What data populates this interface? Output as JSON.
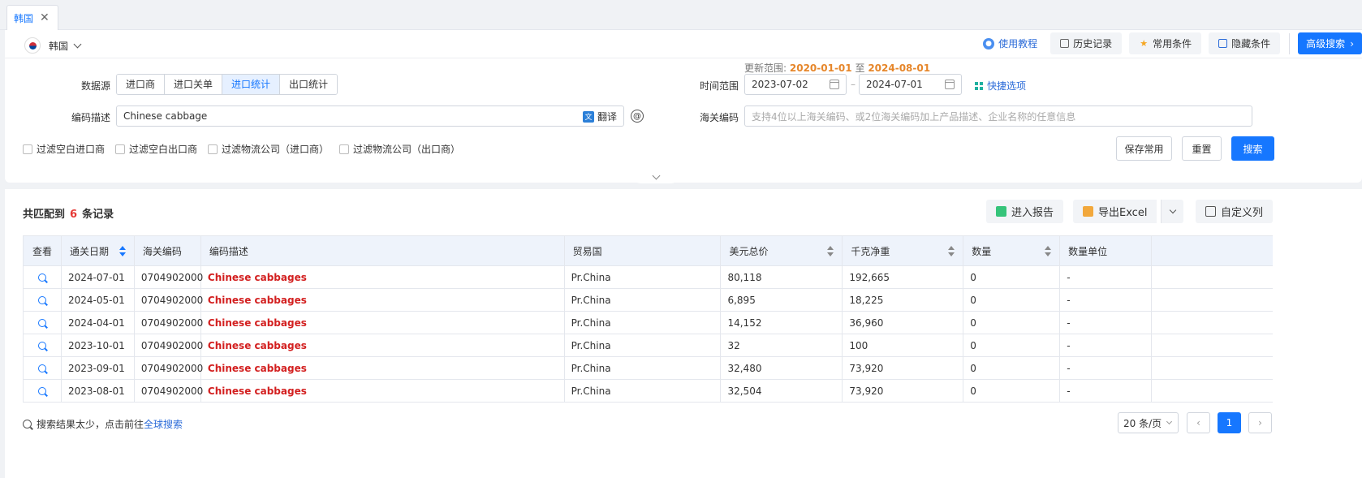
{
  "tab": {
    "label": "韩国",
    "close": "✕"
  },
  "country": {
    "name": "韩国"
  },
  "top_actions": {
    "help": "使用教程",
    "history": "历史记录",
    "common": "常用条件",
    "hide": "隐藏条件",
    "advanced": "高级搜索",
    "advanced_arrow": "›"
  },
  "form": {
    "datasource_label": "数据源",
    "datasource_options": [
      "进口商",
      "进口关单",
      "进口统计",
      "出口统计"
    ],
    "datasource_selected": "进口统计",
    "update_range_prefix": "更新范围:",
    "update_start": "2020-01-01",
    "update_to": "至",
    "update_end": "2024-08-01",
    "time_label": "时间范围",
    "date_from": "2023-07-02",
    "date_to": "2024-07-01",
    "date_sep": "–",
    "quick_options": "快捷选项",
    "desc_label": "编码描述",
    "desc_value": "Chinese cabbage",
    "translate": "翻译",
    "at_symbol": "@",
    "hs_label": "海关编码",
    "hs_placeholder": "支持4位以上海关编码、或2位海关编码加上产品描述、企业名称的任意信息",
    "filters": [
      "过滤空白进口商",
      "过滤空白出口商",
      "过滤物流公司（进口商）",
      "过滤物流公司（出口商）"
    ],
    "save_common": "保存常用",
    "reset": "重置",
    "search": "搜索"
  },
  "results": {
    "prefix": "共匹配到",
    "count": "6",
    "suffix": "条记录",
    "enter_report": "进入报告",
    "export_excel": "导出Excel",
    "custom_columns": "自定义列"
  },
  "table": {
    "headers": [
      "查看",
      "通关日期",
      "海关编码",
      "编码描述",
      "贸易国",
      "美元总价",
      "千克净重",
      "数量",
      "数量单位"
    ],
    "rows": [
      [
        "2024-07-01",
        "0704902000",
        "Chinese cabbages",
        "Pr.China",
        "80,118",
        "192,665",
        "0",
        "-"
      ],
      [
        "2024-05-01",
        "0704902000",
        "Chinese cabbages",
        "Pr.China",
        "6,895",
        "18,225",
        "0",
        "-"
      ],
      [
        "2024-04-01",
        "0704902000",
        "Chinese cabbages",
        "Pr.China",
        "14,152",
        "36,960",
        "0",
        "-"
      ],
      [
        "2023-10-01",
        "0704902000",
        "Chinese cabbages",
        "Pr.China",
        "32",
        "100",
        "0",
        "-"
      ],
      [
        "2023-09-01",
        "0704902000",
        "Chinese cabbages",
        "Pr.China",
        "32,480",
        "73,920",
        "0",
        "-"
      ],
      [
        "2023-08-01",
        "0704902000",
        "Chinese cabbages",
        "Pr.China",
        "32,504",
        "73,920",
        "0",
        "-"
      ]
    ]
  },
  "footer": {
    "hint": "搜索结果太少，点击前往",
    "global_search": "全球搜索",
    "page_size": "20 条/页",
    "prev": "‹",
    "current_page": "1",
    "next": "›"
  },
  "colors": {
    "accent": "#1677ff",
    "highlight_red": "#d32020",
    "orange": "#e6862a"
  },
  "icons": [
    "close-icon",
    "chevron-down-icon",
    "help-icon",
    "history-icon",
    "star-icon",
    "hide-icon",
    "calendar-icon",
    "quick-options-icon",
    "translate-icon",
    "at-icon",
    "report-icon",
    "excel-icon",
    "columns-icon",
    "magnifier-icon",
    "search-icon"
  ]
}
